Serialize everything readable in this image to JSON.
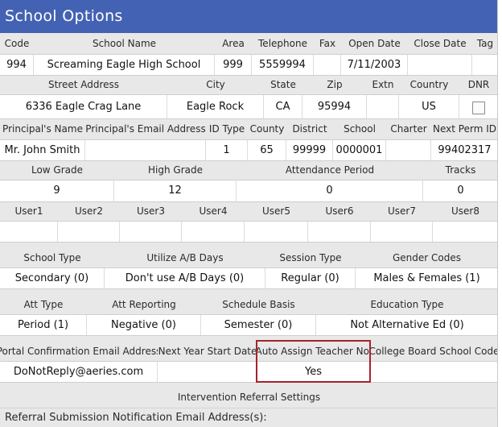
{
  "title": "School Options",
  "row1": {
    "headers": [
      "Code",
      "School Name",
      "Area",
      "Telephone",
      "Fax",
      "Open Date",
      "Close Date",
      "Tag"
    ],
    "values": [
      "994",
      "Screaming Eagle High School",
      "999",
      "5559994",
      "",
      "7/11/2003",
      "",
      ""
    ]
  },
  "row2": {
    "headers": [
      "Street Address",
      "City",
      "State",
      "Zip",
      "Extn",
      "Country",
      "DNR"
    ],
    "values": [
      "6336 Eagle Crag Lane",
      "Eagle Rock",
      "CA",
      "95994",
      "",
      "US"
    ],
    "dnr_checked": false
  },
  "row3": {
    "headers": [
      "Principal's Name",
      "Principal's Email Address",
      "ID Type",
      "County",
      "District",
      "School",
      "Charter",
      "Next Perm ID"
    ],
    "values": [
      "Mr. John Smith",
      "",
      "1",
      "65",
      "99999",
      "0000001",
      "",
      "99402317"
    ]
  },
  "row4": {
    "headers": [
      "Low Grade",
      "High Grade",
      "Attendance Period",
      "Tracks"
    ],
    "values": [
      "9",
      "12",
      "0",
      "0"
    ]
  },
  "row5": {
    "headers": [
      "User1",
      "User2",
      "User3",
      "User4",
      "User5",
      "User6",
      "User7",
      "User8"
    ],
    "values": [
      "",
      "",
      "",
      "",
      "",
      "",
      "",
      ""
    ]
  },
  "row6": {
    "headers": [
      "School Type",
      "Utilize A/B Days",
      "Session Type",
      "Gender Codes"
    ],
    "values": [
      "Secondary (0)",
      "Don't use A/B Days (0)",
      "Regular (0)",
      "Males & Females (1)"
    ]
  },
  "row7": {
    "headers": [
      "Att Type",
      "Att Reporting",
      "Schedule Basis",
      "Education Type"
    ],
    "values": [
      "Period (1)",
      "Negative (0)",
      "Semester (0)",
      "Not Alternative Ed (0)"
    ]
  },
  "row8": {
    "headers": [
      "Portal Confirmation Email Address",
      "Next Year Start Date",
      "Auto Assign Teacher No.",
      "College Board School Code"
    ],
    "values": [
      "DoNotReply@aeries.com",
      "",
      "Yes",
      ""
    ]
  },
  "intervention": {
    "title": "Intervention Referral Settings",
    "notification_label": "Referral Submission Notification Email Address(s):"
  },
  "colors": {
    "title_bar": "#4362b3",
    "header_bg": "#e8e8e8",
    "highlight": "#a8232a"
  }
}
